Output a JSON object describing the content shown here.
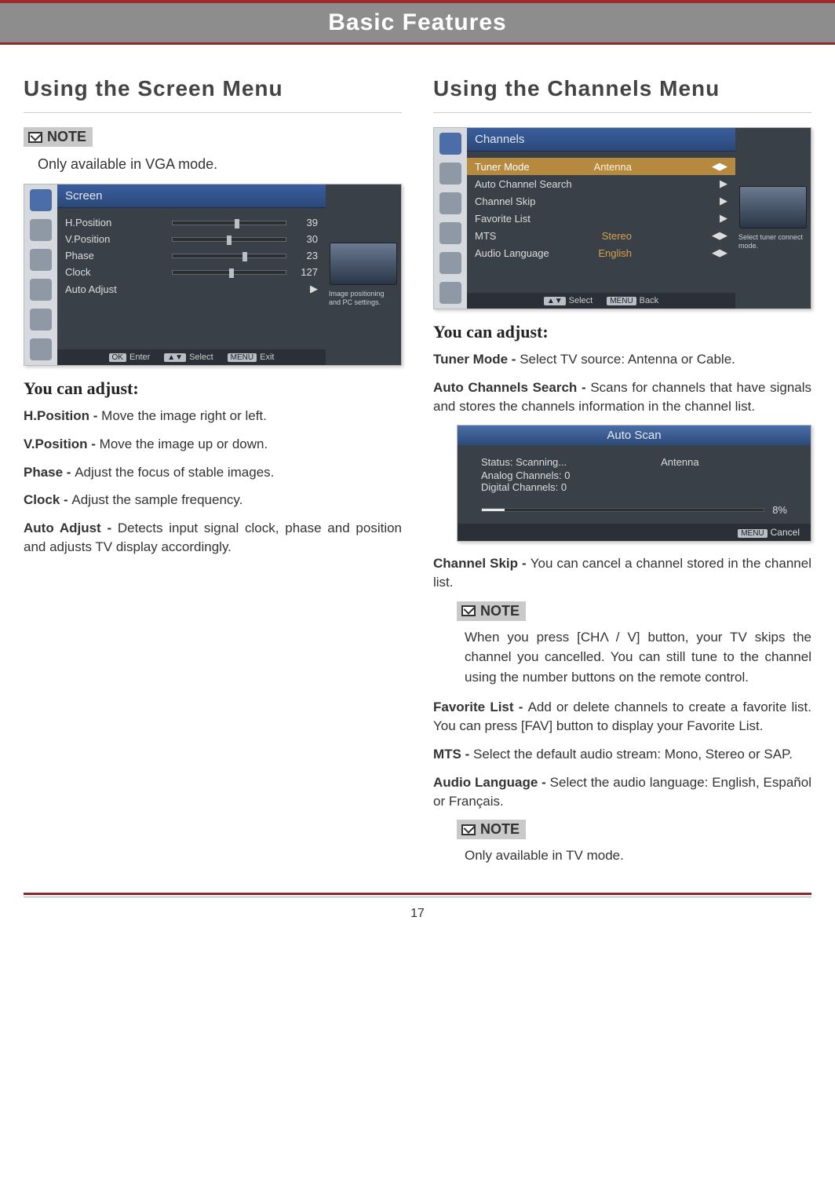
{
  "header": "Basic Features",
  "page_number": "17",
  "left": {
    "title": "Using the Screen Menu",
    "note_label": "NOTE",
    "note_text": "Only available in VGA mode.",
    "osd": {
      "title": "Screen",
      "rows": [
        {
          "label": "H.Position",
          "value": "39",
          "knob": 55
        },
        {
          "label": "V.Position",
          "value": "30",
          "knob": 48
        },
        {
          "label": "Phase",
          "value": "23",
          "knob": 62
        },
        {
          "label": "Clock",
          "value": "127",
          "knob": 50
        }
      ],
      "auto_adjust": "Auto Adjust",
      "side_caption": "Image positioning and PC settings.",
      "hints": {
        "ok": "OK",
        "enter": "Enter",
        "select": "Select",
        "menu": "MENU",
        "exit": "Exit"
      }
    },
    "subhead": "You can adjust:",
    "items": [
      {
        "b": "H.Position - ",
        "t": "Move the image right or left."
      },
      {
        "b": "V.Position - ",
        "t": "Move the image up or down."
      },
      {
        "b": "Phase - ",
        "t": "Adjust the focus of stable images."
      },
      {
        "b": "Clock - ",
        "t": "Adjust the sample frequency."
      },
      {
        "b": "Auto Adjust - ",
        "t": "Detects input signal clock, phase and position and adjusts TV display accordingly."
      }
    ]
  },
  "right": {
    "title": "Using the Channels Menu",
    "osd": {
      "title": "Channels",
      "rows": [
        {
          "label": "Tuner Mode",
          "value": "Antenna",
          "hl": true,
          "arrows": "lr"
        },
        {
          "label": "Auto Channel Search",
          "value": "",
          "arrows": "r"
        },
        {
          "label": "Channel Skip",
          "value": "",
          "arrows": "r"
        },
        {
          "label": "Favorite List",
          "value": "",
          "arrows": "r"
        },
        {
          "label": "MTS",
          "value": "Stereo",
          "arrows": "lr"
        },
        {
          "label": "Audio Language",
          "value": "English",
          "arrows": "lr"
        }
      ],
      "side_caption": "Select tuner connect mode.",
      "hints": {
        "select": "Select",
        "menu": "MENU",
        "back": "Back"
      }
    },
    "subhead": "You can adjust:",
    "tuner": {
      "b": "Tuner Mode - ",
      "t": "Select TV source: Antenna or Cable."
    },
    "autosearch": {
      "b": "Auto Channels Search - ",
      "t": "Scans for channels that have signals and stores the channels information in the channel list."
    },
    "scan": {
      "title": "Auto Scan",
      "status": "Status: Scanning...",
      "source": "Antenna",
      "analog": "Analog Channels: 0",
      "digital": "Digital Channels: 0",
      "percent": "8%",
      "cancel": "Cancel",
      "menu": "MENU"
    },
    "chskip": {
      "b": "Channel Skip - ",
      "t": "You can cancel a channel stored in the channel list."
    },
    "note1_label": "NOTE",
    "note1_text": "When you press [CHΛ / V] button, your TV skips the channel you cancelled. You can still tune to the channel using the number buttons on the remote control.",
    "fav": {
      "b": "Favorite List - ",
      "t": "Add or delete channels to create a favorite list. You can press [FAV] button to display your Favorite List."
    },
    "mts": {
      "b": "MTS - ",
      "t": "Select the default audio stream: Mono, Stereo or SAP."
    },
    "audio": {
      "b": "Audio Language - ",
      "t": "Select the audio language: English, Español or Français."
    },
    "note2_label": "NOTE",
    "note2_text": "Only available in TV mode."
  }
}
